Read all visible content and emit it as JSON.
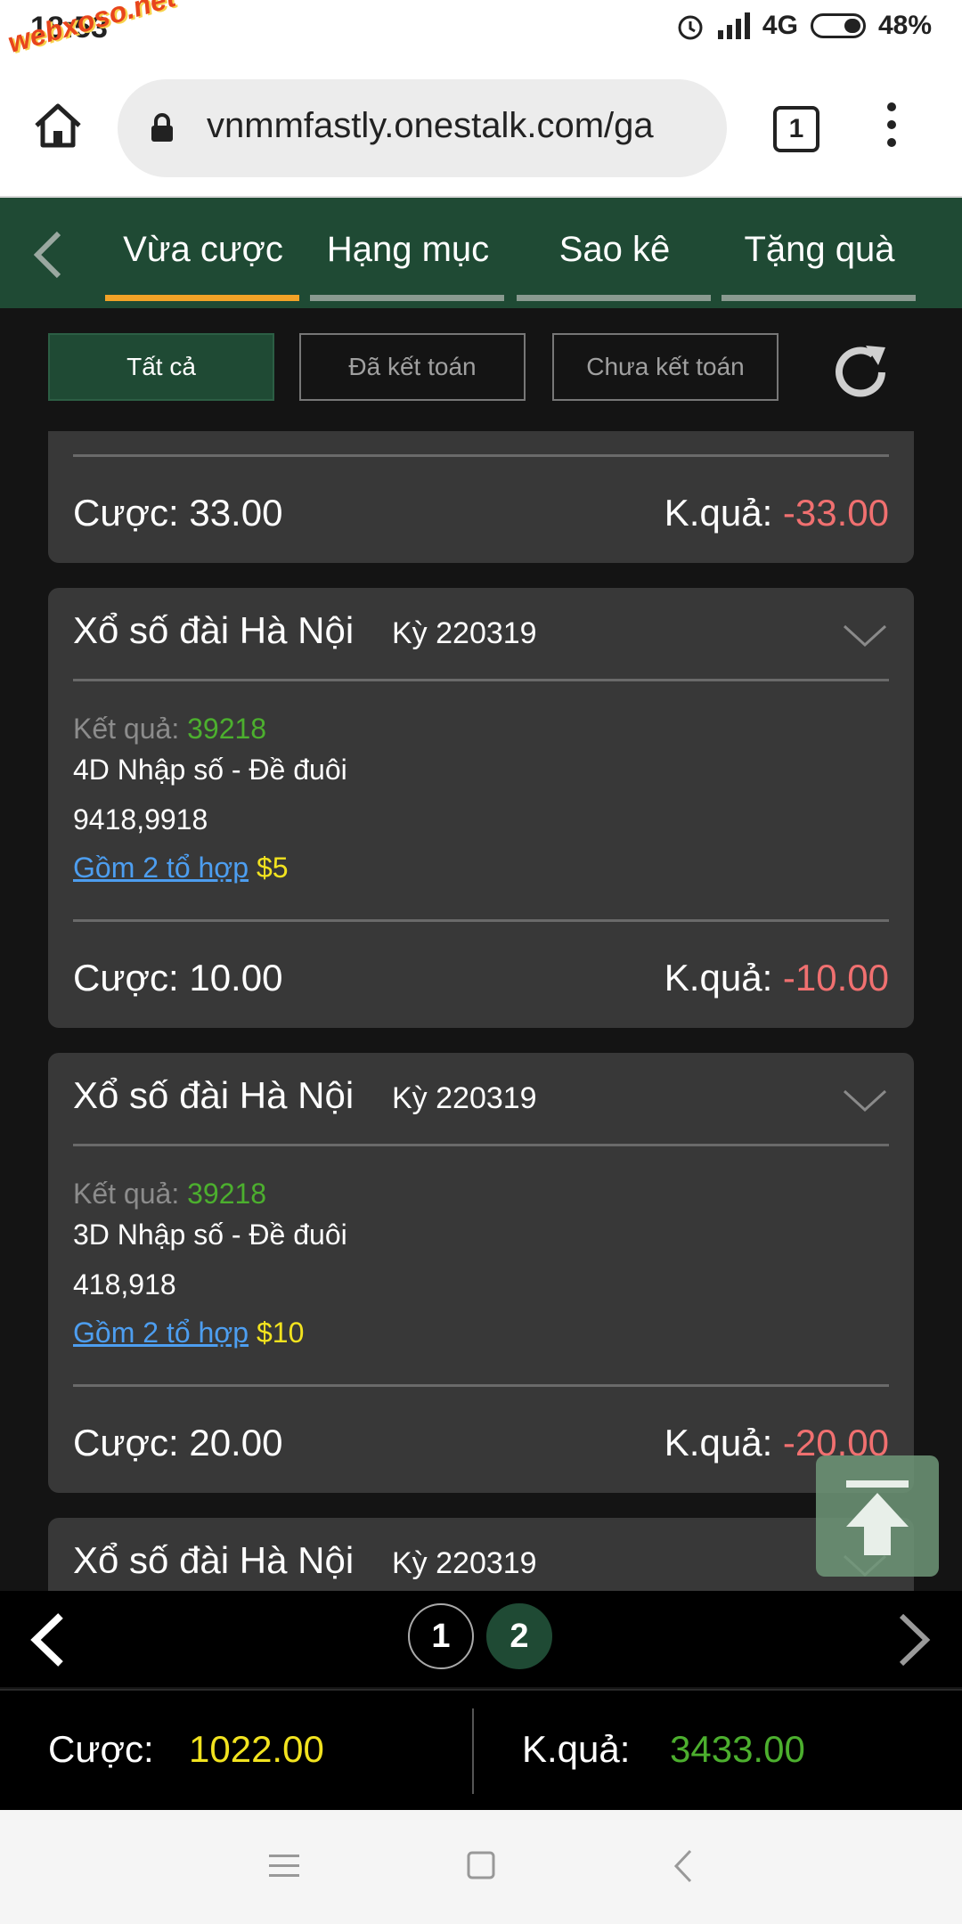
{
  "status_bar": {
    "time": "18:53",
    "network": "4G",
    "battery": "48%",
    "watermark": "webxoso.net"
  },
  "browser": {
    "url": "vnmmfastly.onestalk.com/ga",
    "tab_count": "1"
  },
  "app_nav": {
    "tabs": [
      "Vừa cược",
      "Hạng mục",
      "Sao kê",
      "Tặng quà"
    ],
    "active_tab": 0
  },
  "filters": {
    "all": "Tất cả",
    "settled": "Đã kết toán",
    "unsettled": "Chưa kết toán"
  },
  "cards": [
    {
      "bet_label": "Cược",
      "bet": "33.00",
      "outcome_label": "K.quả",
      "outcome": "-33.00"
    },
    {
      "title": "Xổ số đài Hà Nội",
      "period": "Kỳ 220319",
      "result_label": "Kết quả",
      "result": "39218",
      "bet_type": "4D Nhập số - Đề đuôi",
      "numbers": "9418,9918",
      "combo_link": "Gồm 2 tổ hợp",
      "combo_amount": "$5",
      "bet_label": "Cược",
      "bet": "10.00",
      "outcome_label": "K.quả",
      "outcome": "-10.00"
    },
    {
      "title": "Xổ số đài Hà Nội",
      "period": "Kỳ 220319",
      "result_label": "Kết quả",
      "result": "39218",
      "bet_type": "3D Nhập số - Đề đuôi",
      "numbers": "418,918",
      "combo_link": "Gồm 2 tổ hợp",
      "combo_amount": "$10",
      "bet_label": "Cược",
      "bet": "20.00",
      "outcome_label": "K.quả",
      "outcome": "-20.00"
    },
    {
      "title": "Xổ số đài Hà Nội",
      "period": "Kỳ 220319"
    }
  ],
  "pager": {
    "pages": [
      "1",
      "2"
    ],
    "current": "2"
  },
  "totals": {
    "bet_label": "Cược",
    "bet": "1022.00",
    "outcome_label": "K.quả",
    "outcome": "3433.00"
  },
  "icons": [
    "home-icon",
    "lock-icon",
    "tabs-icon",
    "more-icon",
    "back-icon",
    "refresh-icon",
    "chevron-down-icon",
    "scroll-top-icon",
    "prev-page-icon",
    "next-page-icon",
    "menu-icon",
    "home-square-icon",
    "back-nav-icon"
  ]
}
